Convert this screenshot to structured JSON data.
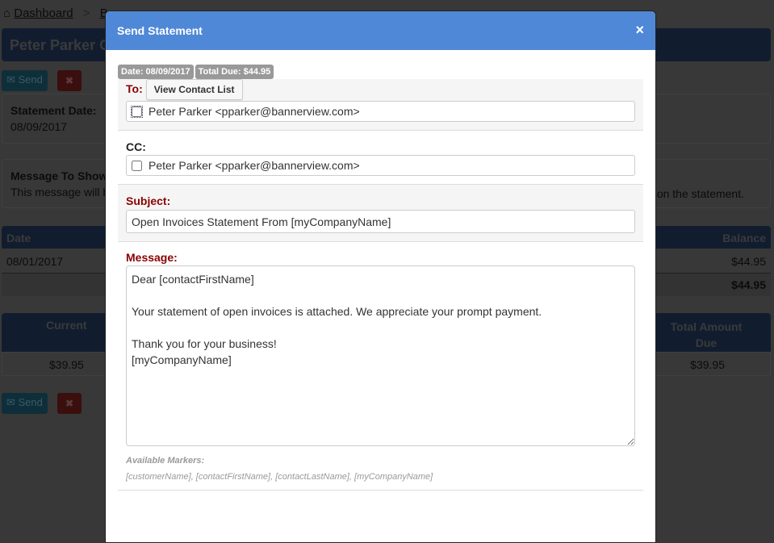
{
  "background": {
    "breadcrumb": {
      "home": "Dashboard",
      "sep": ">",
      "next": "Ba"
    },
    "page_title": "Peter Parker O",
    "send_label": "Send",
    "statement_date_label": "Statement Date:",
    "statement_date": "08/09/2017",
    "message_label": "Message To Show",
    "message_text_left": "This message will b",
    "message_text_right": "on the statement.",
    "table": {
      "col_date": "Date",
      "col_balance": "Balance",
      "row_date": "08/01/2017",
      "row_balance": "$44.95",
      "total": "$44.95"
    },
    "aging": {
      "current_label": "Current",
      "current_value": "$39.95",
      "total_label": "Total Amount Due",
      "total_value": "$39.95"
    }
  },
  "modal": {
    "title": "Send Statement",
    "close": "×",
    "badges": [
      "Date: 08/09/2017",
      "Total Due: $44.95"
    ],
    "to_label": "To:",
    "view_contact_list": "View Contact List",
    "to_contact": "Peter Parker <pparker@bannerview.com>",
    "cc_label": "CC:",
    "cc_contact": "Peter Parker <pparker@bannerview.com>",
    "subject_label": "Subject:",
    "subject_value": "Open Invoices Statement From [myCompanyName]",
    "message_label": "Message:",
    "message_value": "Dear [contactFirstName]\n\nYour statement of open invoices is attached. We appreciate your prompt payment.\n\nThank you for your business!\n[myCompanyName]",
    "markers_label": "Available Markers:",
    "markers": "[customerName], [contactFirstName], [contactLastName], [myCompanyName]"
  },
  "colors": {
    "header": "#5088d8",
    "label_red": "#8b0000",
    "page_bar": "#1f4f8a"
  }
}
